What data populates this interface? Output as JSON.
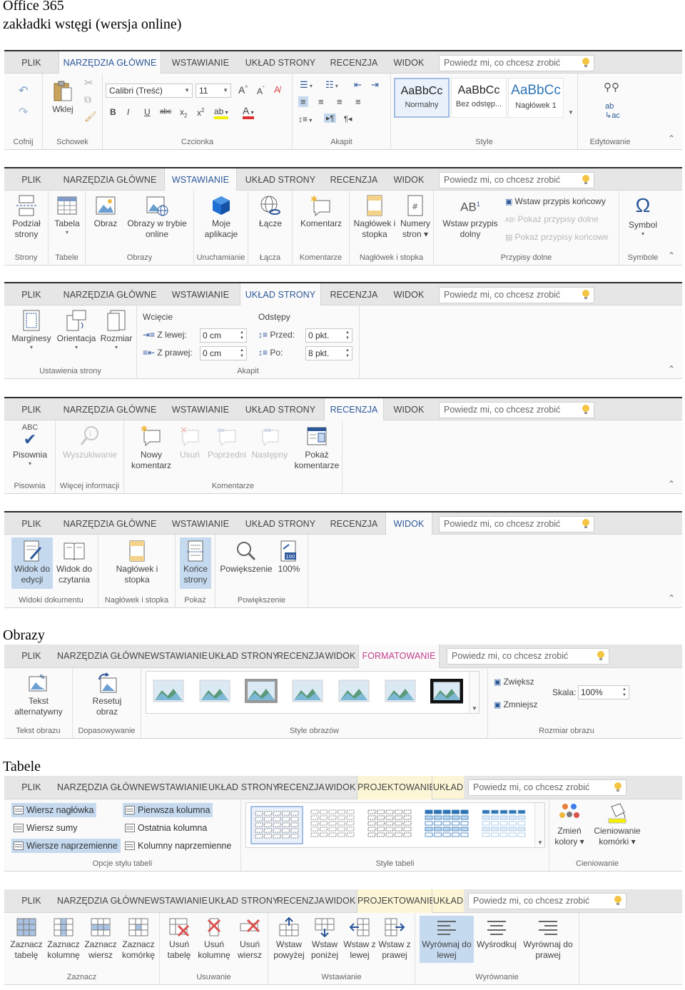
{
  "headings": {
    "main_title": "Office 365",
    "main_subtitle": "zakładki wstęgi (wersja online)",
    "images_section": "Obrazy",
    "tables_section": "Tabele"
  },
  "colors": {
    "active_tab_text": "#2b579a",
    "format_tab_text": "#c43e8c",
    "context_tab_bg": "#fdf6d6",
    "selected_btn_bg": "#c5d9ef",
    "tabbar_bg": "#e6e6e6",
    "ribbon_bg": "#fafafa"
  },
  "tabs": {
    "file": "PLIK",
    "home": "NARZĘDZIA GŁÓWNE",
    "insert": "WSTAWIANIE",
    "layout": "UKŁAD STRONY",
    "review": "RECENZJA",
    "view": "WIDOK",
    "format": "FORMATOWANIE",
    "design": "PROJEKTOWANIE",
    "table_layout": "UKŁAD"
  },
  "tell_me_placeholder": "Powiedz mi, co chcesz zrobić",
  "ribbon_home": {
    "undo_group": "Cofnij",
    "clipboard_group": "Schowek",
    "paste_label": "Wklej",
    "font_group": "Czcionka",
    "font_name": "Calibri (Treść)",
    "font_size": "11",
    "paragraph_group": "Akapit",
    "styles_group": "Style",
    "styles": [
      {
        "sample": "AaBbCc",
        "name": "Normalny"
      },
      {
        "sample": "AaBbCc",
        "name": "Bez odstęp..."
      },
      {
        "sample": "AaBbCc",
        "name": "Nagłówek 1"
      }
    ],
    "editing_group": "Edytowanie"
  },
  "ribbon_insert": {
    "page_break": [
      "Podział",
      "strony"
    ],
    "pages_group": "Strony",
    "table": "Tabela",
    "tables_group": "Tabele",
    "picture": "Obraz",
    "online_pictures": [
      "Obrazy w trybie",
      "online"
    ],
    "pictures_group": "Obrazy",
    "my_apps": [
      "Moje",
      "aplikacje"
    ],
    "launch_group": "Uruchamianie",
    "link": "Łącze",
    "links_group": "Łącza",
    "comment": "Komentarz",
    "comments_group": "Komentarze",
    "header_footer": [
      "Nagłówek i",
      "stopka"
    ],
    "page_numbers": [
      "Numery",
      "stron"
    ],
    "header_footer_group": "Nagłówek i stopka",
    "insert_footnote": [
      "Wstaw przypis",
      "dolny"
    ],
    "insert_endnote": "Wstaw przypis końcowy",
    "show_footnotes": "Pokaż przypisy dolne",
    "show_endnotes": "Pokaż przypisy końcowe",
    "footnotes_group": "Przypisy dolne",
    "symbol": "Symbol",
    "symbols_group": "Symbole"
  },
  "ribbon_layout": {
    "margins": "Marginesy",
    "orientation": "Orientacja",
    "size": "Rozmiar",
    "page_setup_group": "Ustawienia strony",
    "indent": "Wcięcie",
    "indent_left_label": "Z lewej:",
    "indent_left_value": "0 cm",
    "indent_right_label": "Z prawej:",
    "indent_right_value": "0 cm",
    "spacing": "Odstępy",
    "before_label": "Przed:",
    "before_value": "0 pkt.",
    "after_label": "Po:",
    "after_value": "8 pkt.",
    "paragraph_group": "Akapit"
  },
  "ribbon_review": {
    "spelling": "Pisownia",
    "spelling_group": "Pisownia",
    "lookup": "Wyszukiwanie",
    "more_info_group": "Więcej informacji",
    "new_comment": [
      "Nowy",
      "komentarz"
    ],
    "delete": "Usuń",
    "previous": "Poprzedni",
    "next": "Następny",
    "show_comments": [
      "Pokaż",
      "komentarze"
    ],
    "comments_group": "Komentarze"
  },
  "ribbon_view": {
    "edit_view": [
      "Widok do",
      "edycji"
    ],
    "reading_view": [
      "Widok do",
      "czytania"
    ],
    "document_views_group": "Widoki dokumentu",
    "header_footer": [
      "Nagłówek i",
      "stopka"
    ],
    "header_footer_group": "Nagłówek i stopka",
    "page_breaks": [
      "Końce",
      "strony"
    ],
    "show_group": "Pokaż",
    "zoom": "Powiększenie",
    "zoom_100": "100%",
    "zoom_group": "Powiększenie"
  },
  "ribbon_picture": {
    "alt_text": [
      "Tekst",
      "alternatywny"
    ],
    "alt_text_group": "Tekst obrazu",
    "reset_picture": [
      "Resetuj",
      "obraz"
    ],
    "adjust_group": "Dopasowywanie",
    "picture_styles_group": "Style obrazów",
    "grow": "Zwiększ",
    "shrink": "Zmniejsz",
    "scale_label": "Skala:",
    "scale_value": "100%",
    "size_group": "Rozmiar obrazu"
  },
  "ribbon_table_design": {
    "header_row": "Wiersz nagłówka",
    "first_column": "Pierwsza kolumna",
    "total_row": "Wiersz sumy",
    "last_column": "Ostatnia kolumna",
    "banded_rows": "Wiersze naprzemienne",
    "banded_columns": "Kolumny naprzemienne",
    "style_options_group": "Opcje stylu tabeli",
    "table_styles_group": "Style tabeli",
    "change_colors": [
      "Zmień",
      "kolory"
    ],
    "cell_shading": [
      "Cieniowanie",
      "komórki"
    ],
    "shading_group": "Cieniowanie"
  },
  "ribbon_table_layout": {
    "select_table": [
      "Zaznacz",
      "tabelę"
    ],
    "select_column": [
      "Zaznacz",
      "kolumnę"
    ],
    "select_row": [
      "Zaznacz",
      "wiersz"
    ],
    "select_cell": [
      "Zaznacz",
      "komórkę"
    ],
    "select_group": "Zaznacz",
    "delete_table": [
      "Usuń",
      "tabelę"
    ],
    "delete_column": [
      "Usuń",
      "kolumnę"
    ],
    "delete_row": [
      "Usuń",
      "wiersz"
    ],
    "delete_group": "Usuwanie",
    "insert_above": [
      "Wstaw",
      "powyżej"
    ],
    "insert_below": [
      "Wstaw",
      "poniżej"
    ],
    "insert_left": [
      "Wstaw z",
      "lewej"
    ],
    "insert_right": [
      "Wstaw z",
      "prawej"
    ],
    "insert_group": "Wstawianie",
    "align_left": [
      "Wyrównaj do",
      "lewej"
    ],
    "center": "Wyśrodkuj",
    "align_right": [
      "Wyrównaj do",
      "prawej"
    ],
    "alignment_group": "Wyrównanie"
  }
}
